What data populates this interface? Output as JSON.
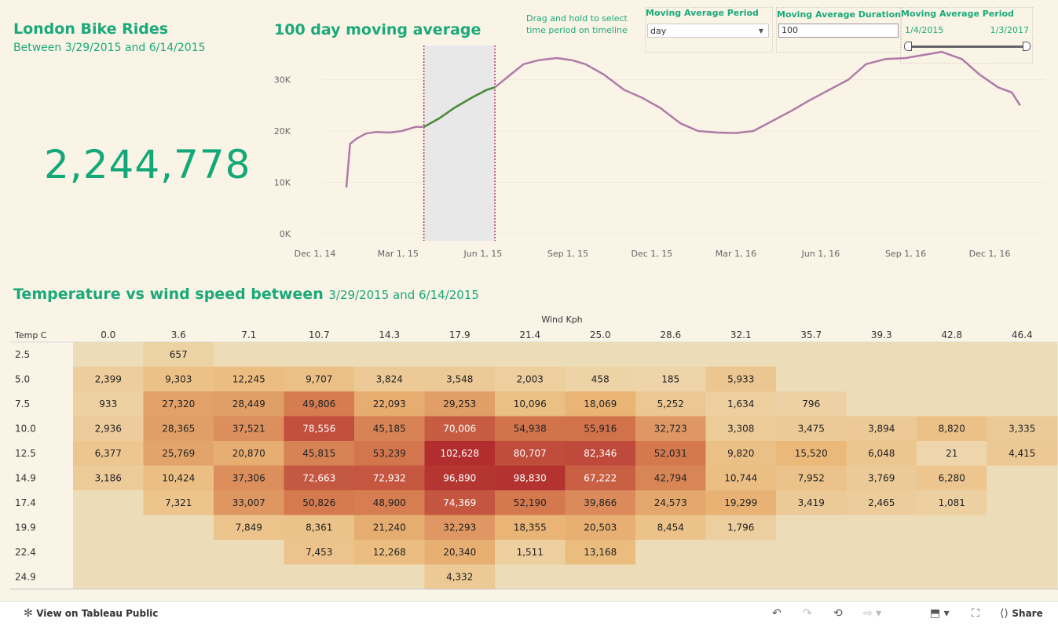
{
  "header": {
    "title": "London Bike Rides",
    "subtitle": "Between 3/29/2015 and 6/14/2015",
    "total": "2,244,778"
  },
  "line_chart_title": "100 day moving average",
  "drag_hint": "Drag and hold to select time period on timeline",
  "controls": {
    "period_label": "Moving Average Period",
    "period_value": "day",
    "duration_label": "Moving Average Duration",
    "duration_value": "100",
    "range_label": "Moving Average Period",
    "range_start": "1/4/2015",
    "range_end": "1/3/2017"
  },
  "heatmap_title": "Temperature vs wind speed between",
  "heatmap_title_range": "3/29/2015 and 6/14/2015",
  "colors": {
    "accent": "#1aa97a",
    "line": "#b07aa8",
    "highlight": "#4a8d3c",
    "selection": "#e8e8e8",
    "marker": "#c0315a"
  },
  "toolbar": {
    "view_label": "View on Tableau Public",
    "share_label": "Share",
    "icons": [
      "undo-icon",
      "redo-icon",
      "revert-icon",
      "refresh-icon",
      "download-icon",
      "fullscreen-icon",
      "share-icon"
    ]
  },
  "chart_data": [
    {
      "type": "line",
      "title": "100 day moving average",
      "x_ticks": [
        "Dec 1, 14",
        "Mar 1, 15",
        "Jun 1, 15",
        "Sep 1, 15",
        "Dec 1, 15",
        "Mar 1, 16",
        "Jun 1, 16",
        "Sep 1, 16",
        "Dec 1, 16"
      ],
      "y_ticks": [
        "0K",
        "10K",
        "20K",
        "30K"
      ],
      "ylim": [
        0,
        38000
      ],
      "selection": {
        "start": "2015-03-29",
        "end": "2015-06-14"
      },
      "series": [
        {
          "x": [
            "2015-01-04",
            "2015-01-08",
            "2015-01-15",
            "2015-01-25",
            "2015-02-05",
            "2015-02-20",
            "2015-03-05",
            "2015-03-20",
            "2015-03-29",
            "2015-04-15",
            "2015-05-01",
            "2015-05-20",
            "2015-06-05",
            "2015-06-14",
            "2015-07-01",
            "2015-07-15",
            "2015-08-01",
            "2015-08-20",
            "2015-09-05",
            "2015-09-20",
            "2015-10-10",
            "2015-11-01",
            "2015-11-20",
            "2015-12-10",
            "2016-01-01",
            "2016-01-20",
            "2016-02-10",
            "2016-03-01",
            "2016-03-20",
            "2016-04-10",
            "2016-05-01",
            "2016-05-20",
            "2016-06-10",
            "2016-07-01",
            "2016-07-20",
            "2016-08-10",
            "2016-09-01",
            "2016-09-20",
            "2016-10-10",
            "2016-11-01",
            "2016-11-20",
            "2016-12-10",
            "2016-12-25",
            "2017-01-03"
          ],
          "y": [
            9000,
            17500,
            18500,
            19500,
            19800,
            19700,
            20000,
            20800,
            20800,
            22500,
            24500,
            26500,
            28000,
            28500,
            31000,
            33000,
            33800,
            34200,
            33800,
            33000,
            31000,
            28000,
            26500,
            24500,
            21500,
            20000,
            19700,
            19600,
            20000,
            22000,
            24000,
            26000,
            28000,
            30000,
            33000,
            34000,
            34200,
            34800,
            35400,
            34000,
            31000,
            28500,
            27500,
            25000
          ]
        }
      ]
    },
    {
      "type": "heatmap",
      "title": "Temperature vs wind speed between 3/29/2015 and 6/14/2015",
      "xlabel": "Wind Kph",
      "ylabel": "Temp C",
      "x": [
        "0.0",
        "3.6",
        "7.1",
        "10.7",
        "14.3",
        "17.9",
        "21.4",
        "25.0",
        "28.6",
        "32.1",
        "35.7",
        "39.3",
        "42.8",
        "46.4"
      ],
      "y": [
        "2.5",
        "5.0",
        "7.5",
        "10.0",
        "12.5",
        "14.9",
        "17.4",
        "19.9",
        "22.4",
        "24.9"
      ],
      "values": [
        [
          null,
          657,
          null,
          null,
          null,
          null,
          null,
          null,
          null,
          null,
          null,
          null,
          null,
          null
        ],
        [
          2399,
          9303,
          12245,
          9707,
          3824,
          3548,
          2003,
          458,
          185,
          5933,
          null,
          null,
          null,
          null
        ],
        [
          933,
          27320,
          28449,
          49806,
          22093,
          29253,
          10096,
          18069,
          5252,
          1634,
          796,
          null,
          null,
          null
        ],
        [
          2936,
          28365,
          37521,
          78556,
          45185,
          70006,
          54938,
          55916,
          32723,
          3308,
          3475,
          3894,
          8820,
          3335
        ],
        [
          6377,
          25769,
          20870,
          45815,
          53239,
          102628,
          80707,
          82346,
          52031,
          9820,
          15520,
          6048,
          21,
          4415
        ],
        [
          3186,
          10424,
          37306,
          72663,
          72932,
          96890,
          98830,
          67222,
          42794,
          10744,
          7952,
          3769,
          6280,
          null
        ],
        [
          null,
          7321,
          33007,
          50826,
          48900,
          74369,
          52190,
          39866,
          24573,
          19299,
          3419,
          2465,
          1081,
          null
        ],
        [
          null,
          null,
          7849,
          8361,
          21240,
          32293,
          18355,
          20503,
          8454,
          1796,
          null,
          null,
          null,
          null
        ],
        [
          null,
          null,
          null,
          7453,
          12268,
          20340,
          1511,
          13168,
          null,
          null,
          null,
          null,
          null,
          null
        ],
        [
          null,
          null,
          null,
          null,
          null,
          4332,
          null,
          null,
          null,
          null,
          null,
          null,
          null,
          null
        ]
      ]
    }
  ]
}
